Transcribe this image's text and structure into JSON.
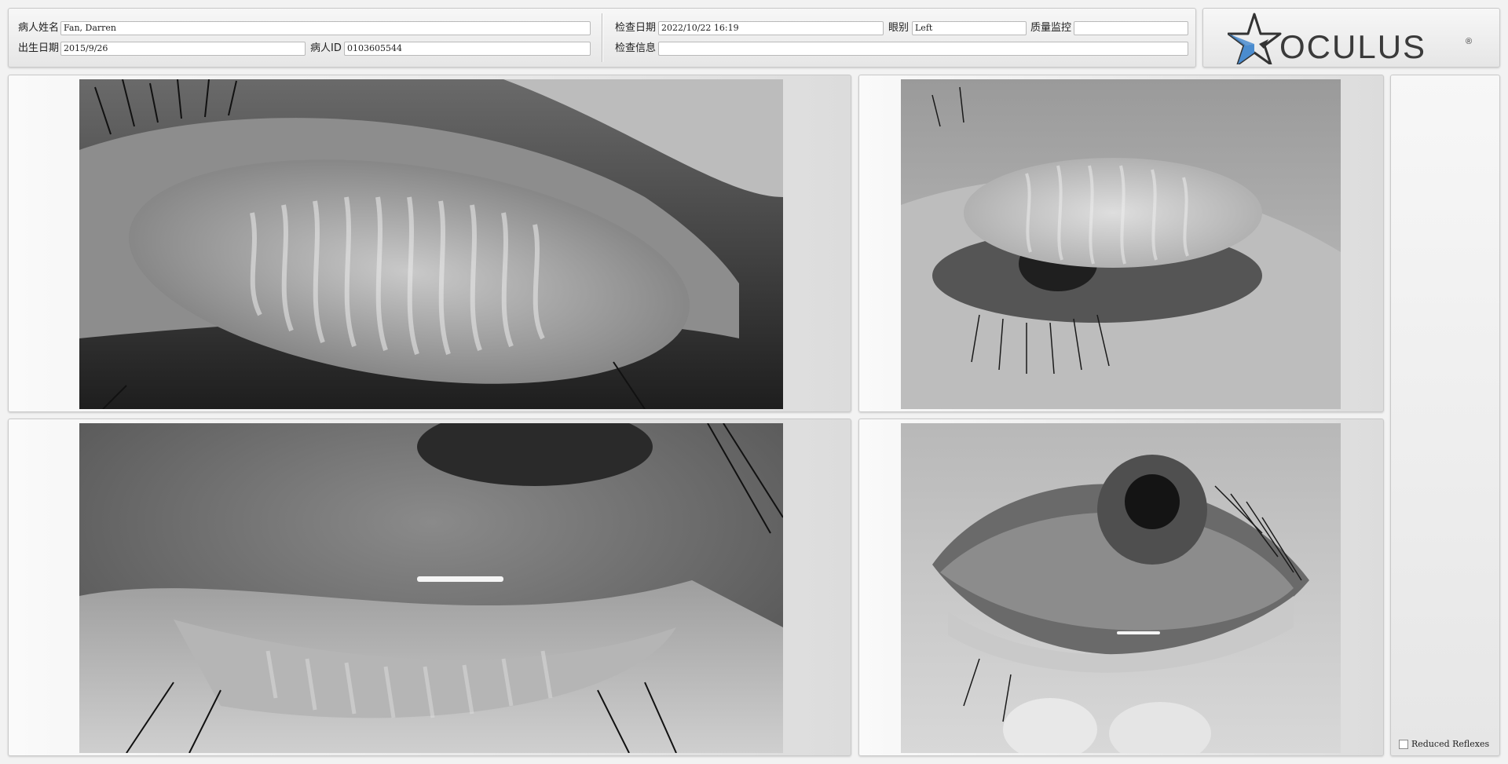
{
  "patient": {
    "name_label": "病人姓名",
    "name_value": "Fan, Darren",
    "dob_label": "出生日期",
    "dob_value": "2015/9/26",
    "id_label": "病人ID",
    "id_value": "0103605544"
  },
  "exam": {
    "date_label": "检查日期",
    "date_value": "2022/10/22 16:19",
    "eye_label": "眼别",
    "eye_value": "Left",
    "qc_label": "质量监控",
    "qc_value": "",
    "info_label": "检查信息",
    "info_value": ""
  },
  "logo": {
    "text": "OCULUS",
    "mark": "®",
    "colors": {
      "star": "#333333",
      "accent": "#4a8ccf"
    }
  },
  "images": [
    {
      "name": "meibography-upper-lid"
    },
    {
      "name": "eye-upper-lid-everted"
    },
    {
      "name": "meibography-lower-lid"
    },
    {
      "name": "eye-lower-lid-everted"
    }
  ],
  "options": {
    "reduced_reflexes_label": "Reduced Reflexes",
    "reduced_reflexes_checked": false
  }
}
